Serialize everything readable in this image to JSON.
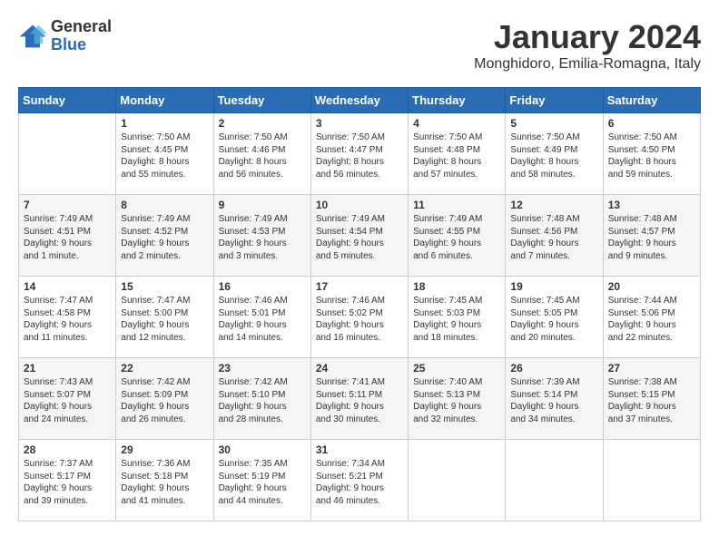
{
  "header": {
    "logo": {
      "general": "General",
      "blue": "Blue"
    },
    "title": "January 2024",
    "subtitle": "Monghidoro, Emilia-Romagna, Italy"
  },
  "days_of_week": [
    "Sunday",
    "Monday",
    "Tuesday",
    "Wednesday",
    "Thursday",
    "Friday",
    "Saturday"
  ],
  "weeks": [
    [
      {
        "day": "",
        "info": ""
      },
      {
        "day": "1",
        "info": "Sunrise: 7:50 AM\nSunset: 4:45 PM\nDaylight: 8 hours\nand 55 minutes."
      },
      {
        "day": "2",
        "info": "Sunrise: 7:50 AM\nSunset: 4:46 PM\nDaylight: 8 hours\nand 56 minutes."
      },
      {
        "day": "3",
        "info": "Sunrise: 7:50 AM\nSunset: 4:47 PM\nDaylight: 8 hours\nand 56 minutes."
      },
      {
        "day": "4",
        "info": "Sunrise: 7:50 AM\nSunset: 4:48 PM\nDaylight: 8 hours\nand 57 minutes."
      },
      {
        "day": "5",
        "info": "Sunrise: 7:50 AM\nSunset: 4:49 PM\nDaylight: 8 hours\nand 58 minutes."
      },
      {
        "day": "6",
        "info": "Sunrise: 7:50 AM\nSunset: 4:50 PM\nDaylight: 8 hours\nand 59 minutes."
      }
    ],
    [
      {
        "day": "7",
        "info": "Sunrise: 7:49 AM\nSunset: 4:51 PM\nDaylight: 9 hours\nand 1 minute."
      },
      {
        "day": "8",
        "info": "Sunrise: 7:49 AM\nSunset: 4:52 PM\nDaylight: 9 hours\nand 2 minutes."
      },
      {
        "day": "9",
        "info": "Sunrise: 7:49 AM\nSunset: 4:53 PM\nDaylight: 9 hours\nand 3 minutes."
      },
      {
        "day": "10",
        "info": "Sunrise: 7:49 AM\nSunset: 4:54 PM\nDaylight: 9 hours\nand 5 minutes."
      },
      {
        "day": "11",
        "info": "Sunrise: 7:49 AM\nSunset: 4:55 PM\nDaylight: 9 hours\nand 6 minutes."
      },
      {
        "day": "12",
        "info": "Sunrise: 7:48 AM\nSunset: 4:56 PM\nDaylight: 9 hours\nand 7 minutes."
      },
      {
        "day": "13",
        "info": "Sunrise: 7:48 AM\nSunset: 4:57 PM\nDaylight: 9 hours\nand 9 minutes."
      }
    ],
    [
      {
        "day": "14",
        "info": "Sunrise: 7:47 AM\nSunset: 4:58 PM\nDaylight: 9 hours\nand 11 minutes."
      },
      {
        "day": "15",
        "info": "Sunrise: 7:47 AM\nSunset: 5:00 PM\nDaylight: 9 hours\nand 12 minutes."
      },
      {
        "day": "16",
        "info": "Sunrise: 7:46 AM\nSunset: 5:01 PM\nDaylight: 9 hours\nand 14 minutes."
      },
      {
        "day": "17",
        "info": "Sunrise: 7:46 AM\nSunset: 5:02 PM\nDaylight: 9 hours\nand 16 minutes."
      },
      {
        "day": "18",
        "info": "Sunrise: 7:45 AM\nSunset: 5:03 PM\nDaylight: 9 hours\nand 18 minutes."
      },
      {
        "day": "19",
        "info": "Sunrise: 7:45 AM\nSunset: 5:05 PM\nDaylight: 9 hours\nand 20 minutes."
      },
      {
        "day": "20",
        "info": "Sunrise: 7:44 AM\nSunset: 5:06 PM\nDaylight: 9 hours\nand 22 minutes."
      }
    ],
    [
      {
        "day": "21",
        "info": "Sunrise: 7:43 AM\nSunset: 5:07 PM\nDaylight: 9 hours\nand 24 minutes."
      },
      {
        "day": "22",
        "info": "Sunrise: 7:42 AM\nSunset: 5:09 PM\nDaylight: 9 hours\nand 26 minutes."
      },
      {
        "day": "23",
        "info": "Sunrise: 7:42 AM\nSunset: 5:10 PM\nDaylight: 9 hours\nand 28 minutes."
      },
      {
        "day": "24",
        "info": "Sunrise: 7:41 AM\nSunset: 5:11 PM\nDaylight: 9 hours\nand 30 minutes."
      },
      {
        "day": "25",
        "info": "Sunrise: 7:40 AM\nSunset: 5:13 PM\nDaylight: 9 hours\nand 32 minutes."
      },
      {
        "day": "26",
        "info": "Sunrise: 7:39 AM\nSunset: 5:14 PM\nDaylight: 9 hours\nand 34 minutes."
      },
      {
        "day": "27",
        "info": "Sunrise: 7:38 AM\nSunset: 5:15 PM\nDaylight: 9 hours\nand 37 minutes."
      }
    ],
    [
      {
        "day": "28",
        "info": "Sunrise: 7:37 AM\nSunset: 5:17 PM\nDaylight: 9 hours\nand 39 minutes."
      },
      {
        "day": "29",
        "info": "Sunrise: 7:36 AM\nSunset: 5:18 PM\nDaylight: 9 hours\nand 41 minutes."
      },
      {
        "day": "30",
        "info": "Sunrise: 7:35 AM\nSunset: 5:19 PM\nDaylight: 9 hours\nand 44 minutes."
      },
      {
        "day": "31",
        "info": "Sunrise: 7:34 AM\nSunset: 5:21 PM\nDaylight: 9 hours\nand 46 minutes."
      },
      {
        "day": "",
        "info": ""
      },
      {
        "day": "",
        "info": ""
      },
      {
        "day": "",
        "info": ""
      }
    ]
  ]
}
